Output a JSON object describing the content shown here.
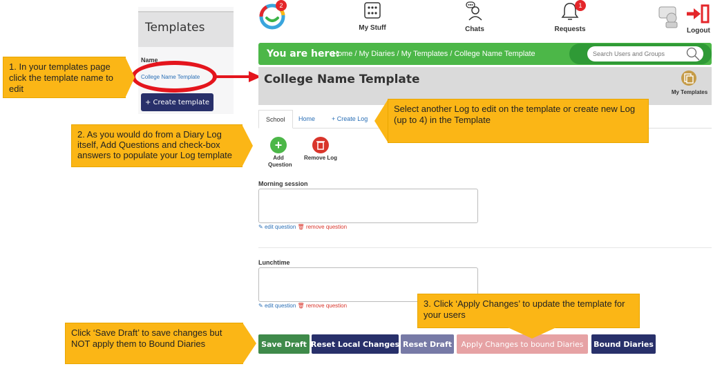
{
  "templates_panel": {
    "title": "Templates",
    "name_header": "Name",
    "template_link": "College Name Template",
    "create_button": "+ Create template"
  },
  "nav": {
    "logo_badge": "2",
    "my_stuff": "My Stuff",
    "chats": "Chats",
    "requests": "Requests",
    "requests_badge": "1",
    "logout": "Logout"
  },
  "breadcrumb": {
    "label": "You are here:",
    "trail": "Home  /  My Diaries  /  My Templates  /  College Name Template",
    "search_placeholder": "Search Users and Groups"
  },
  "page": {
    "title": "College Name Template",
    "my_templates": "My Templates"
  },
  "tabs": {
    "school": "School",
    "home": "Home",
    "create_log": "+ Create Log"
  },
  "actions": {
    "add_question": "Add Question",
    "remove_log": "Remove Log"
  },
  "questions": [
    {
      "label": "Morning session",
      "edit": "edit question",
      "remove": "remove question"
    },
    {
      "label": "Lunchtime",
      "edit": "edit question",
      "remove": "remove question"
    }
  ],
  "buttons": {
    "save_draft": "Save Draft",
    "reset_local": "Reset Local Changes",
    "reset_draft": "Reset Draft",
    "apply_changes": "Apply Changes to bound Diaries",
    "bound_diaries": "Bound Diaries"
  },
  "callouts": {
    "c1": "1. In your templates page click the template name to edit",
    "c2": "2. As you would do from a Diary Log itself, Add Questions and check-box answers to populate your Log template",
    "c3": "Select another Log to edit on the template or create new Log (up to 4) in the Template",
    "c4": "3. Click ‘Apply Changes’ to update the template for your users",
    "c5": "Click ‘Save Draft’ to save changes but NOT apply them to Bound Diaries"
  },
  "colors": {
    "green_bar": "#4cb748",
    "navy_button": "#28306a",
    "callout": "#fbb616",
    "annotation_red": "#e4151d"
  }
}
